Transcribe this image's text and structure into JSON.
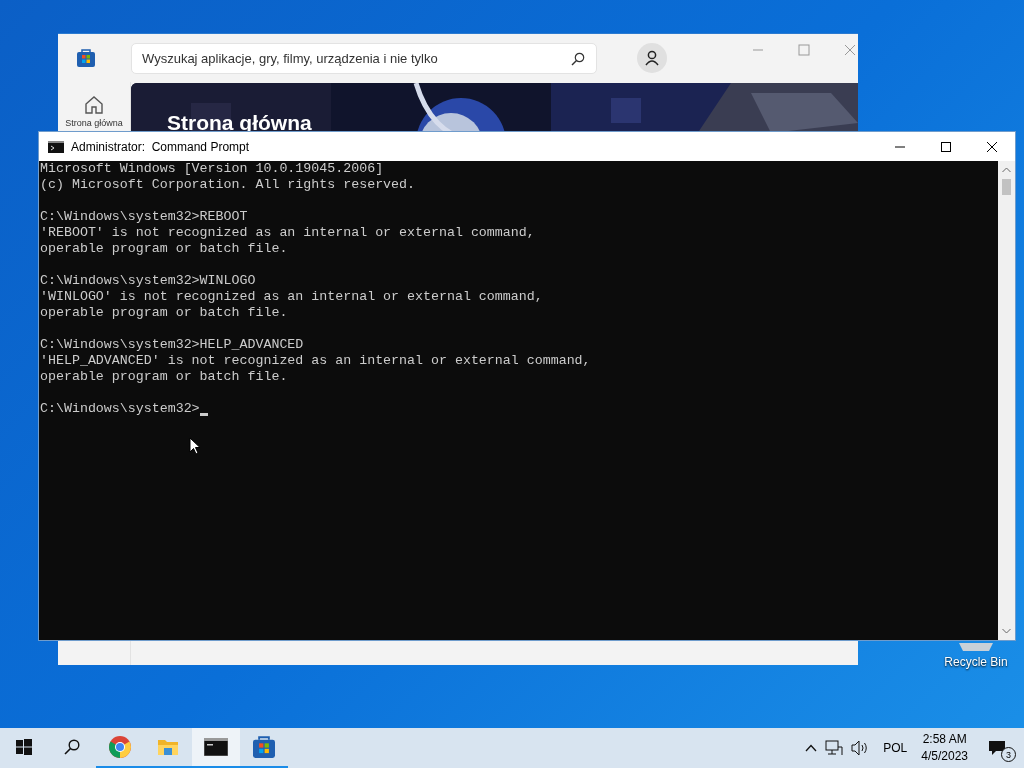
{
  "desktop": {
    "icons": [
      {
        "label": "Recycle Bin"
      }
    ]
  },
  "store_window": {
    "search": {
      "placeholder": "Wyszukaj aplikacje, gry, filmy, urządzenia i nie tylko"
    },
    "nav": [
      {
        "label": "Strona główna"
      }
    ],
    "hero": {
      "kind": "picture",
      "title": "Strona główna"
    }
  },
  "cmd_window": {
    "title": "Administrator:  Command Prompt",
    "blocks": [
      [
        "Microsoft Windows [Version 10.0.19045.2006]",
        "(c) Microsoft Corporation. All rights reserved."
      ],
      [
        "C:\\Windows\\system32>REBOOT",
        "'REBOOT' is not recognized as an internal or external command,",
        "operable program or batch file."
      ],
      [
        "C:\\Windows\\system32>WINLOGO",
        "'WINLOGO' is not recognized as an internal or external command,",
        "operable program or batch file."
      ],
      [
        "C:\\Windows\\system32>HELP_ADVANCED",
        "'HELP_ADVANCED' is not recognized as an internal or external command,",
        "operable program or batch file."
      ],
      [
        "C:\\Windows\\system32>"
      ]
    ],
    "cursor": true
  },
  "taskbar": {
    "apps": [
      {
        "kind": "start",
        "running": false,
        "selected": false
      },
      {
        "kind": "search",
        "running": false,
        "selected": false
      },
      {
        "kind": "chrome",
        "running": true,
        "selected": false
      },
      {
        "kind": "explorer",
        "running": true,
        "selected": false
      },
      {
        "kind": "terminal",
        "running": true,
        "selected": true
      },
      {
        "kind": "store",
        "running": true,
        "selected": false
      }
    ],
    "tray": {
      "language": "POL",
      "time": "2:58 AM",
      "date": "4/5/2023",
      "notifications": "3"
    }
  }
}
